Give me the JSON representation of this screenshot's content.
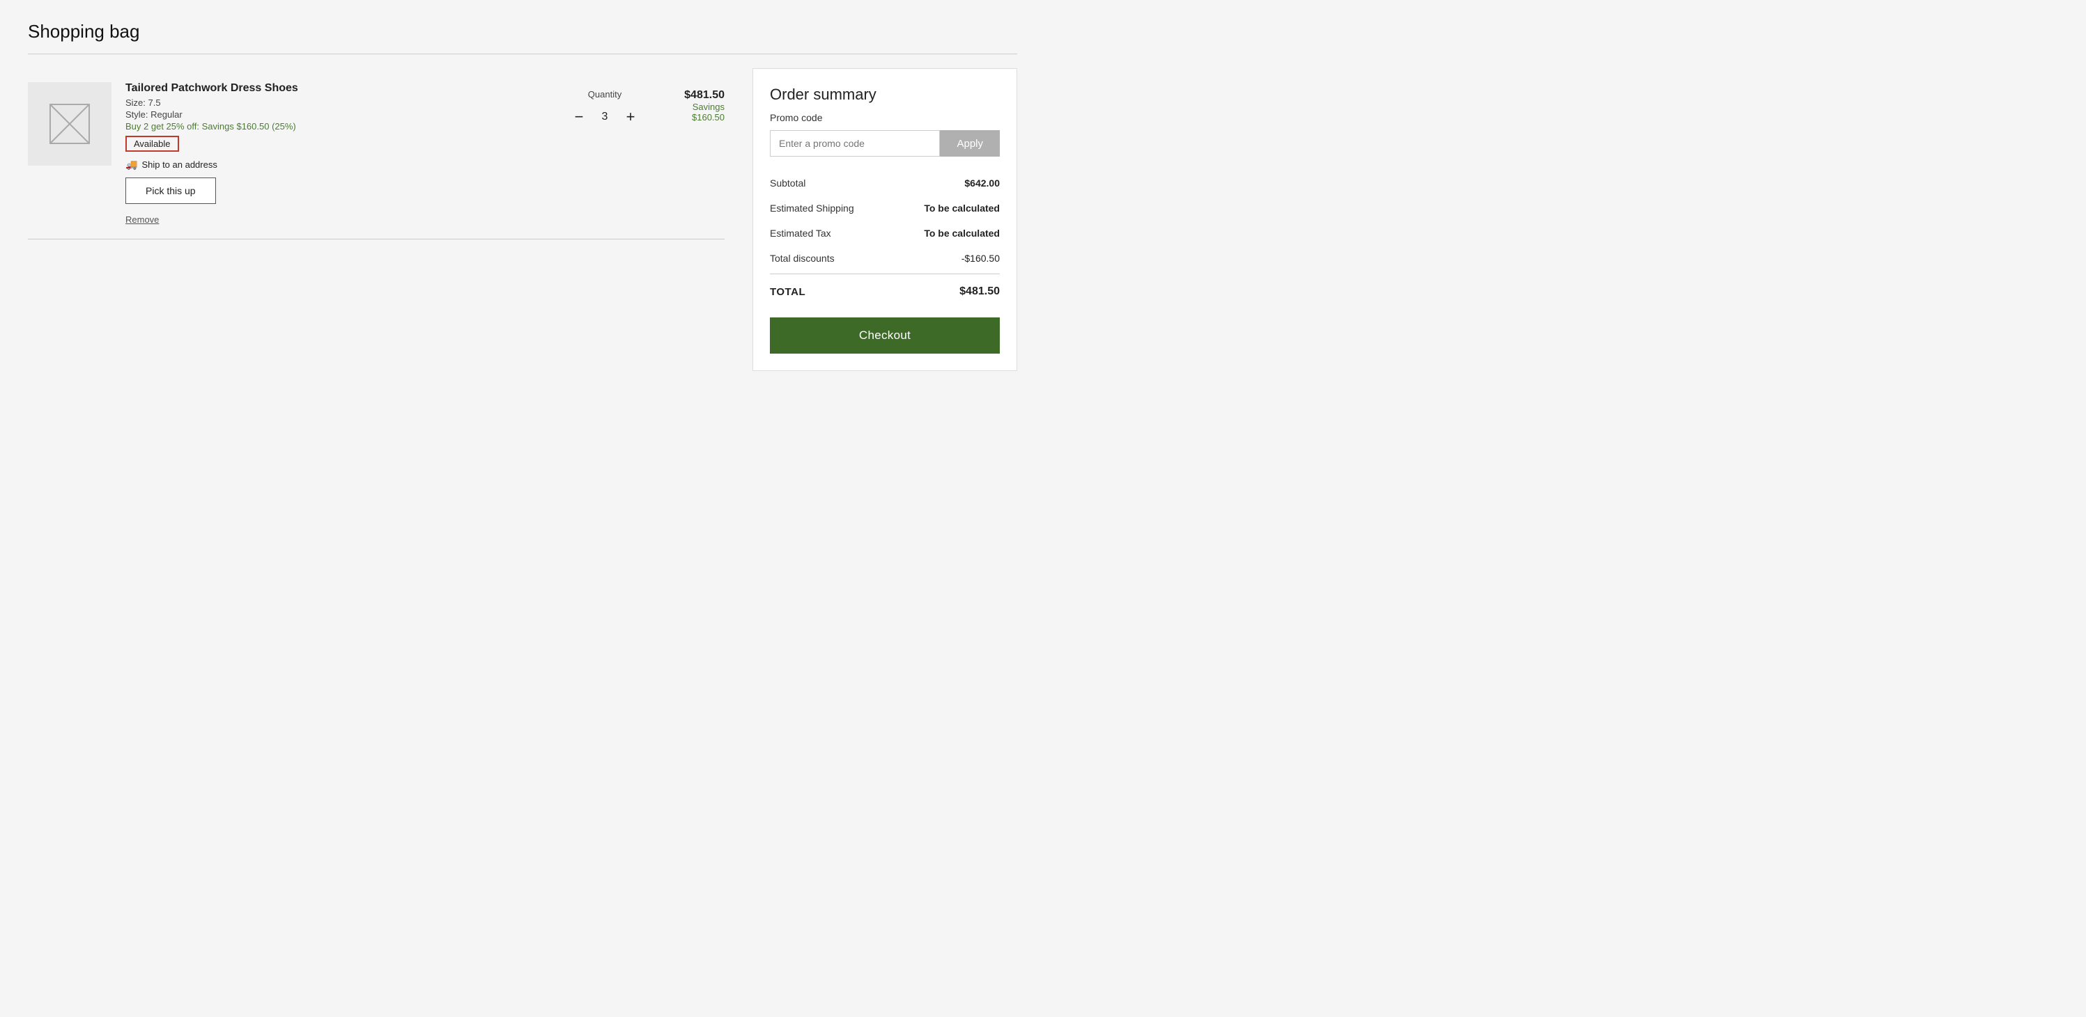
{
  "page": {
    "title": "Shopping bag"
  },
  "cart": {
    "items": [
      {
        "id": "item-1",
        "name": "Tailored Patchwork Dress Shoes",
        "size": "Size: 7.5",
        "style": "Style: Regular",
        "promo": "Buy 2 get 25% off: Savings $160.50 (25%)",
        "availability": "Available",
        "ship_option": "Ship to an address",
        "pickup_label": "Pick this up",
        "remove_label": "Remove",
        "quantity_label": "Quantity",
        "quantity": "3",
        "price": "$481.50",
        "savings_label": "Savings",
        "savings_amount": "$160.50"
      }
    ]
  },
  "order_summary": {
    "title": "Order summary",
    "promo_code_label": "Promo code",
    "promo_code_placeholder": "Enter a promo code",
    "apply_label": "Apply",
    "rows": [
      {
        "label": "Subtotal",
        "value": "$642.00",
        "bold": true
      },
      {
        "label": "Estimated Shipping",
        "value": "To be calculated",
        "bold": true
      },
      {
        "label": "Estimated Tax",
        "value": "To be calculated",
        "bold": true
      },
      {
        "label": "Total discounts",
        "value": "-$160.50",
        "bold": false
      }
    ],
    "total_label": "TOTAL",
    "total_value": "$481.50",
    "checkout_label": "Checkout"
  },
  "icons": {
    "image_placeholder": "image-icon",
    "ship": "truck-icon",
    "minus": "−",
    "plus": "+"
  },
  "colors": {
    "green_button": "#3d6b27",
    "promo_green": "#4a7c2f",
    "available_border": "#c0392b",
    "apply_bg": "#b0b0b0"
  }
}
